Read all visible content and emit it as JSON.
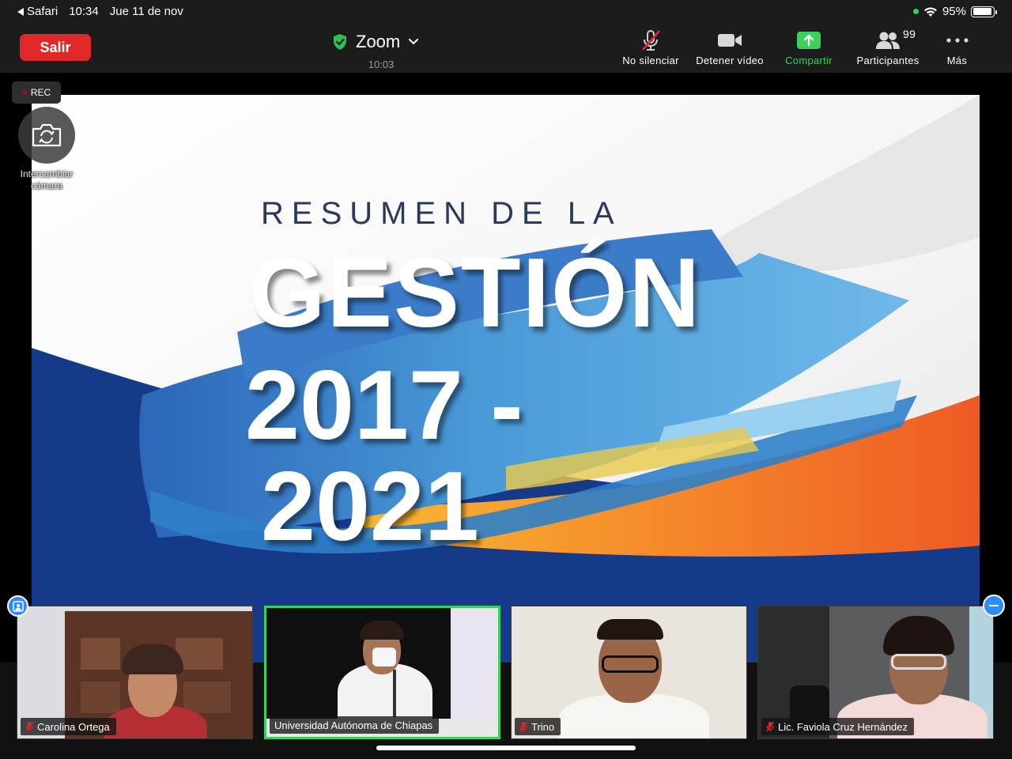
{
  "status_bar": {
    "back_app": "Safari",
    "time": "10:34",
    "date": "Jue 11 de nov",
    "battery": "95%",
    "battery_level": 0.95
  },
  "toolbar": {
    "leave_label": "Salir",
    "meeting_title": "Zoom",
    "meeting_timer": "10:03",
    "controls": [
      {
        "label": "No silenciar",
        "icon": "muted-mic-icon"
      },
      {
        "label": "Detener vídeo",
        "icon": "video-camera-icon"
      },
      {
        "label": "Compartir",
        "icon": "share-screen-icon"
      },
      {
        "label": "Participantes",
        "icon": "participants-icon"
      },
      {
        "label": "Más",
        "icon": "more-dots-icon"
      }
    ],
    "participant_count": "99",
    "accent_color": "#3ad15a",
    "leave_color": "#e02828"
  },
  "recording": {
    "label": "REC"
  },
  "camera_switch": {
    "label": "Intercambiar cámara"
  },
  "slide": {
    "subtitle": "RESUMEN DE LA",
    "title": "GESTIÓN",
    "years_line1": "2017 -",
    "years_line2": "2021"
  },
  "participants": [
    {
      "name": "Carolina Ortega",
      "muted": true
    },
    {
      "name": "Universidad Autónoma de Chiapas",
      "muted": false,
      "active_speaker": true
    },
    {
      "name": "Trino",
      "muted": true
    },
    {
      "name": "Lic. Faviola Cruz Hernández",
      "muted": true
    }
  ]
}
